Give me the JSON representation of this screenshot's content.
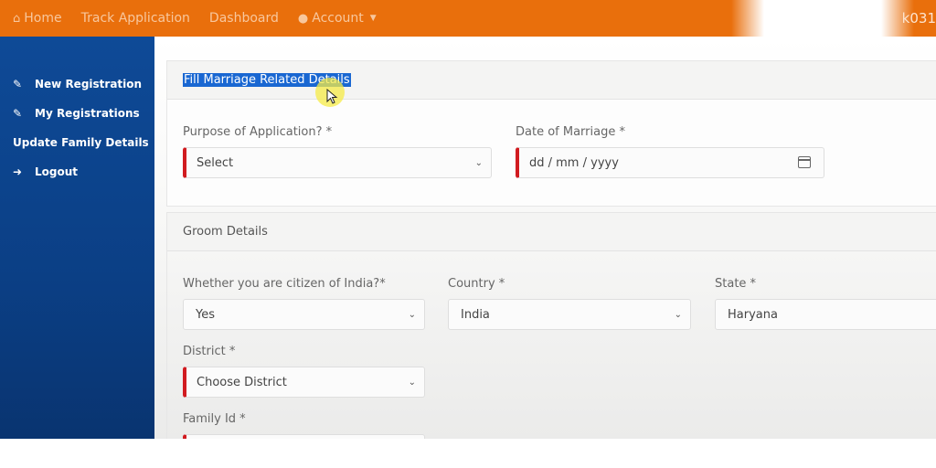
{
  "topbar": {
    "nav": [
      {
        "icon": "home-icon",
        "glyph": "🏠",
        "label": "Home"
      },
      {
        "label": "Track Application"
      },
      {
        "label": "Dashboard"
      },
      {
        "icon": "user-icon",
        "glyph": "👤",
        "label": "Account",
        "caret": "▼"
      }
    ],
    "user_id_partial": "k031"
  },
  "sidebar": {
    "items": [
      {
        "icon": "edit-icon",
        "glyph": "✎",
        "label": "New Registration"
      },
      {
        "icon": "edit-icon",
        "glyph": "✎",
        "label": "My Registrations"
      },
      {
        "label": "Update Family Details"
      },
      {
        "icon": "logout-icon",
        "glyph": "➜",
        "label": "Logout"
      }
    ]
  },
  "marriage_card": {
    "title": "Fill Marriage Related Details",
    "purpose": {
      "label": "Purpose of Application? *",
      "value": "Select"
    },
    "date": {
      "label": "Date of Marriage *",
      "placeholder": "dd / mm / yyyy"
    }
  },
  "groom_card": {
    "title": "Groom Details",
    "citizen": {
      "label": "Whether you are citizen of India?*",
      "value": "Yes"
    },
    "country": {
      "label": "Country *",
      "value": "India"
    },
    "state": {
      "label": "State *",
      "value": "Haryana"
    },
    "district": {
      "label": "District *",
      "value": "Choose District"
    },
    "family_id": {
      "label": "Family Id *",
      "value": ""
    }
  },
  "icons": {
    "chevron": "⌄"
  }
}
